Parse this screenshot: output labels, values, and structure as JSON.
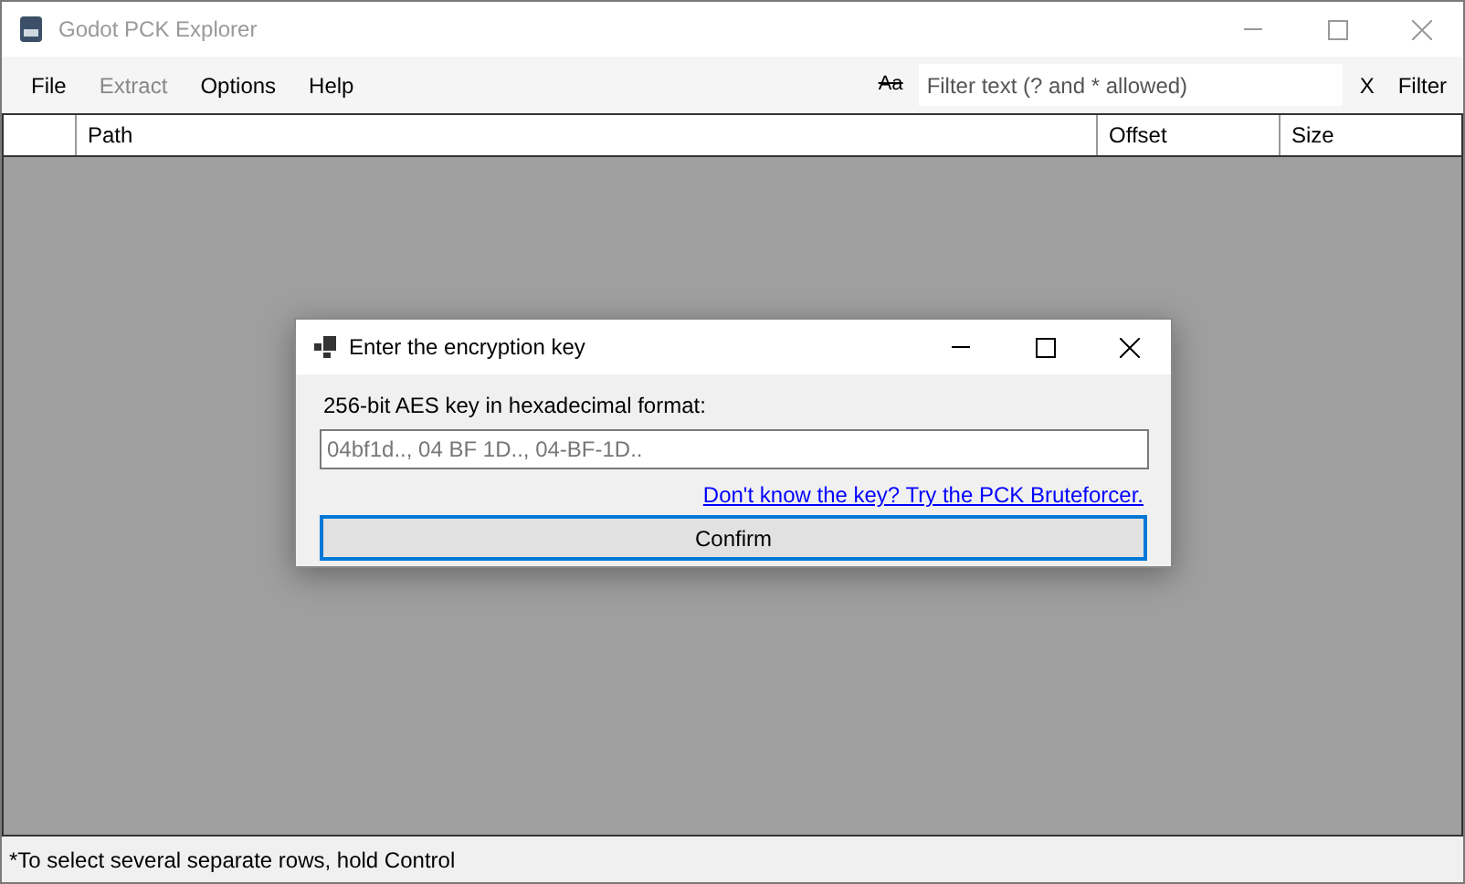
{
  "window": {
    "title": "Godot PCK Explorer"
  },
  "menu": [
    {
      "label": "File",
      "disabled": false
    },
    {
      "label": "Extract",
      "disabled": true
    },
    {
      "label": "Options",
      "disabled": false
    },
    {
      "label": "Help",
      "disabled": false
    }
  ],
  "filter": {
    "case_toggle": "Aa",
    "placeholder": "Filter text (? and * allowed)",
    "clear": "X",
    "button": "Filter"
  },
  "table": {
    "columns": [
      "Path",
      "Offset",
      "Size"
    ]
  },
  "dialog": {
    "title": "Enter the encryption key",
    "label": "256-bit AES key in hexadecimal format:",
    "placeholder": "04bf1d.., 04 BF 1D.., 04-BF-1D..",
    "link": "Don't know the key? Try the PCK Bruteforcer.",
    "button": "Confirm"
  },
  "status_bar": "*To select several separate rows, hold Control"
}
